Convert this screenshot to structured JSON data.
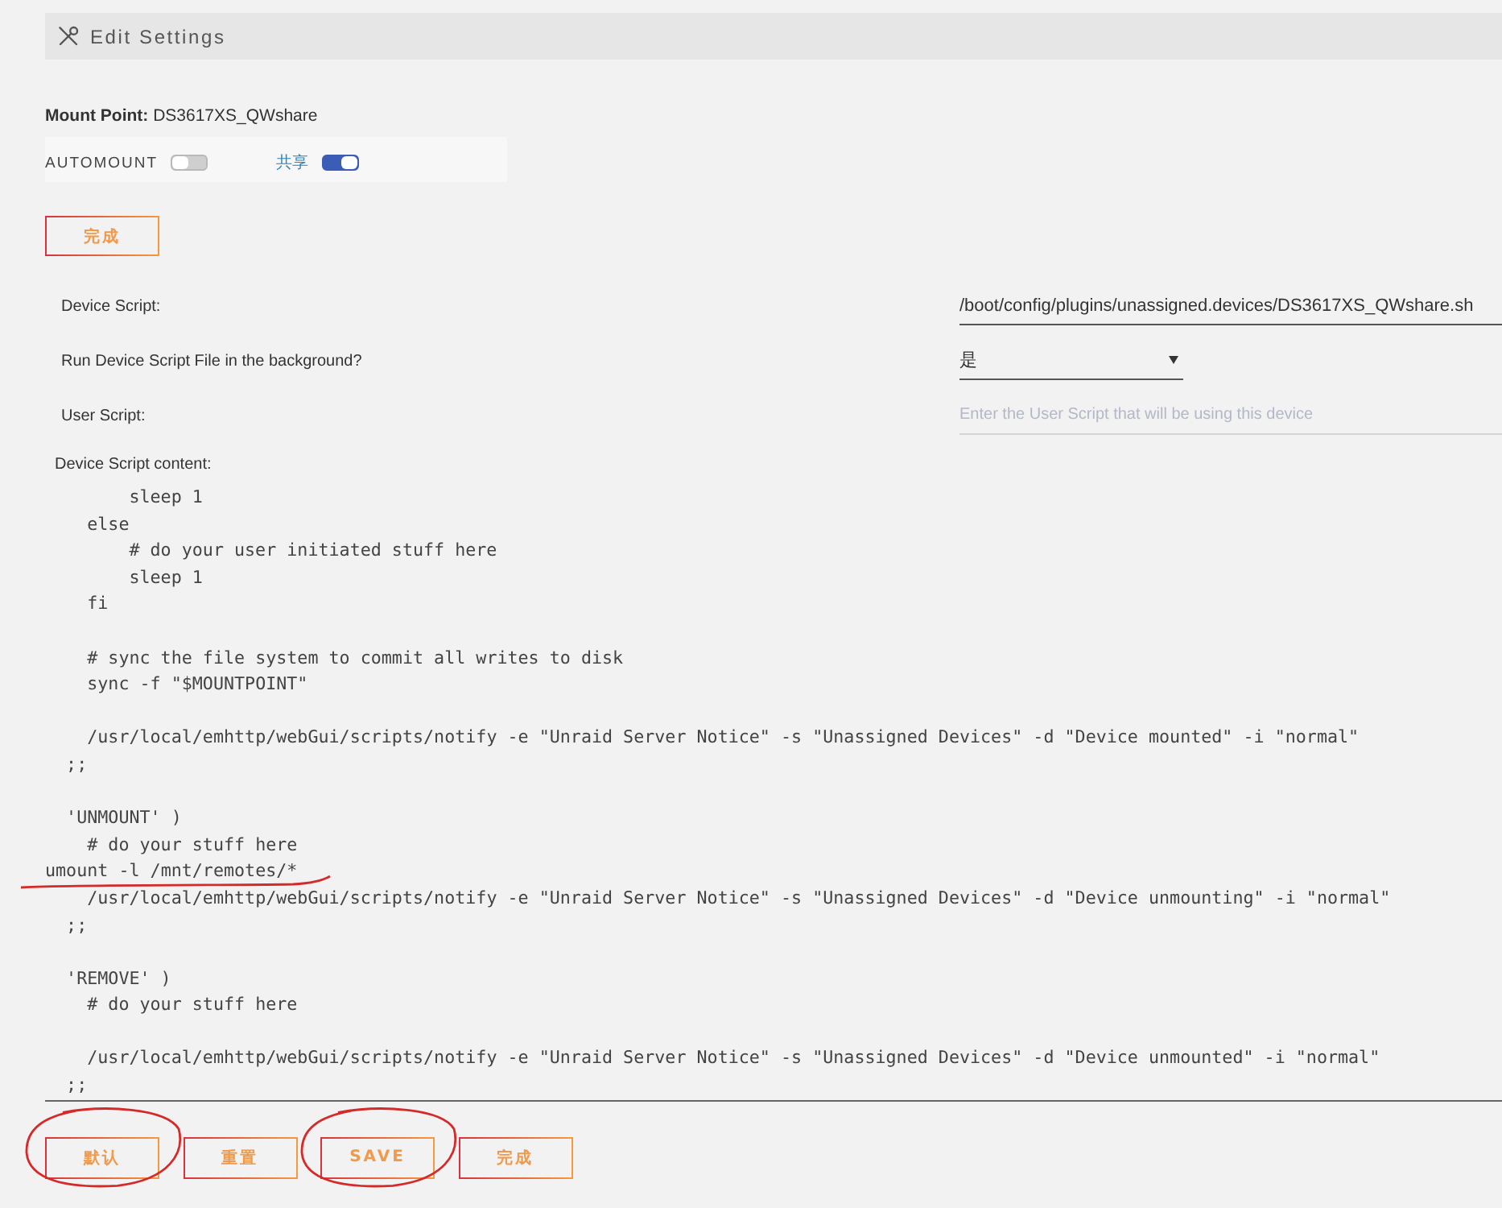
{
  "header": {
    "title": "Edit Settings"
  },
  "mount_point": "**Mount Point:** DS3617XS_QWshare",
  "toggles": [
    {
      "label": "AUTOMOUNT",
      "on": false,
      "color": "#444444"
    },
    {
      "label": "共享",
      "on": true,
      "color": "#2a86b8"
    }
  ],
  "done_button": {
    "label": "完成"
  },
  "settings": [
    {
      "kind": "text",
      "label": "Device Script:",
      "value": "/boot/config/plugins/unassigned.devices/DS3617XS_QWshare.sh"
    },
    {
      "kind": "select",
      "label": "Run Device Script File in the background?",
      "value": "是"
    },
    {
      "kind": "input",
      "label": "User Script:",
      "placeholder": "Enter the User Script that will be using this device"
    }
  ],
  "script_content": {
    "label": "Device Script content:",
    "blocks": [
      [
        {
          "text": "        sleep 1",
          "underlined": false
        },
        {
          "text": "    else",
          "underlined": false
        },
        {
          "text": "        # do your user initiated stuff here",
          "underlined": false
        },
        {
          "text": "        sleep 1",
          "underlined": false
        },
        {
          "text": "    fi",
          "underlined": false
        }
      ],
      [
        {
          "text": "    # sync the file system to commit all writes to disk",
          "underlined": false
        },
        {
          "text": "    sync -f \"$MOUNTPOINT\"",
          "underlined": false
        }
      ],
      [
        {
          "text": "    /usr/local/emhttp/webGui/scripts/notify -e \"Unraid Server Notice\" -s \"Unassigned Devices\" -d \"Device mounted\" -i \"normal\"",
          "underlined": false
        },
        {
          "text": "  ;;",
          "underlined": false
        }
      ],
      [
        {
          "text": "  'UNMOUNT' )",
          "underlined": false
        },
        {
          "text": "    # do your stuff here",
          "underlined": false
        },
        {
          "text": "umount -l /mnt/remotes/*",
          "underlined": true
        },
        {
          "text": "    /usr/local/emhttp/webGui/scripts/notify -e \"Unraid Server Notice\" -s \"Unassigned Devices\" -d \"Device unmounting\" -i \"normal\"",
          "underlined": false
        },
        {
          "text": "  ;;",
          "underlined": false
        }
      ],
      [
        {
          "text": "  'REMOVE' )",
          "underlined": false
        },
        {
          "text": "    # do your stuff here",
          "underlined": false
        }
      ],
      [
        {
          "text": "    /usr/local/emhttp/webGui/scripts/notify -e \"Unraid Server Notice\" -s \"Unassigned Devices\" -d \"Device unmounted\" -i \"normal\"",
          "underlined": false
        },
        {
          "text": "  ;;",
          "underlined": false
        }
      ]
    ]
  },
  "buttons": [
    {
      "label": "默认",
      "circled": true
    },
    {
      "label": "重置",
      "circled": false
    },
    {
      "label": "SAVE",
      "circled": true
    },
    {
      "label": "完成",
      "circled": false
    }
  ]
}
